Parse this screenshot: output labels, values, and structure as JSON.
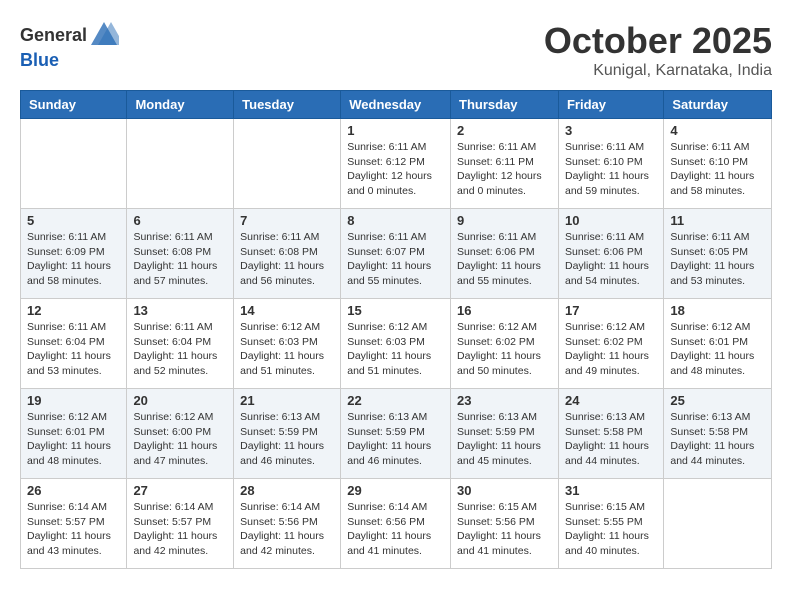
{
  "header": {
    "logo_general": "General",
    "logo_blue": "Blue",
    "month_title": "October 2025",
    "location": "Kunigal, Karnataka, India"
  },
  "weekdays": [
    "Sunday",
    "Monday",
    "Tuesday",
    "Wednesday",
    "Thursday",
    "Friday",
    "Saturday"
  ],
  "weeks": [
    [
      {
        "day": "",
        "sunrise": "",
        "sunset": "",
        "daylight": ""
      },
      {
        "day": "",
        "sunrise": "",
        "sunset": "",
        "daylight": ""
      },
      {
        "day": "",
        "sunrise": "",
        "sunset": "",
        "daylight": ""
      },
      {
        "day": "1",
        "sunrise": "Sunrise: 6:11 AM",
        "sunset": "Sunset: 6:12 PM",
        "daylight": "Daylight: 12 hours and 0 minutes."
      },
      {
        "day": "2",
        "sunrise": "Sunrise: 6:11 AM",
        "sunset": "Sunset: 6:11 PM",
        "daylight": "Daylight: 12 hours and 0 minutes."
      },
      {
        "day": "3",
        "sunrise": "Sunrise: 6:11 AM",
        "sunset": "Sunset: 6:10 PM",
        "daylight": "Daylight: 11 hours and 59 minutes."
      },
      {
        "day": "4",
        "sunrise": "Sunrise: 6:11 AM",
        "sunset": "Sunset: 6:10 PM",
        "daylight": "Daylight: 11 hours and 58 minutes."
      }
    ],
    [
      {
        "day": "5",
        "sunrise": "Sunrise: 6:11 AM",
        "sunset": "Sunset: 6:09 PM",
        "daylight": "Daylight: 11 hours and 58 minutes."
      },
      {
        "day": "6",
        "sunrise": "Sunrise: 6:11 AM",
        "sunset": "Sunset: 6:08 PM",
        "daylight": "Daylight: 11 hours and 57 minutes."
      },
      {
        "day": "7",
        "sunrise": "Sunrise: 6:11 AM",
        "sunset": "Sunset: 6:08 PM",
        "daylight": "Daylight: 11 hours and 56 minutes."
      },
      {
        "day": "8",
        "sunrise": "Sunrise: 6:11 AM",
        "sunset": "Sunset: 6:07 PM",
        "daylight": "Daylight: 11 hours and 55 minutes."
      },
      {
        "day": "9",
        "sunrise": "Sunrise: 6:11 AM",
        "sunset": "Sunset: 6:06 PM",
        "daylight": "Daylight: 11 hours and 55 minutes."
      },
      {
        "day": "10",
        "sunrise": "Sunrise: 6:11 AM",
        "sunset": "Sunset: 6:06 PM",
        "daylight": "Daylight: 11 hours and 54 minutes."
      },
      {
        "day": "11",
        "sunrise": "Sunrise: 6:11 AM",
        "sunset": "Sunset: 6:05 PM",
        "daylight": "Daylight: 11 hours and 53 minutes."
      }
    ],
    [
      {
        "day": "12",
        "sunrise": "Sunrise: 6:11 AM",
        "sunset": "Sunset: 6:04 PM",
        "daylight": "Daylight: 11 hours and 53 minutes."
      },
      {
        "day": "13",
        "sunrise": "Sunrise: 6:11 AM",
        "sunset": "Sunset: 6:04 PM",
        "daylight": "Daylight: 11 hours and 52 minutes."
      },
      {
        "day": "14",
        "sunrise": "Sunrise: 6:12 AM",
        "sunset": "Sunset: 6:03 PM",
        "daylight": "Daylight: 11 hours and 51 minutes."
      },
      {
        "day": "15",
        "sunrise": "Sunrise: 6:12 AM",
        "sunset": "Sunset: 6:03 PM",
        "daylight": "Daylight: 11 hours and 51 minutes."
      },
      {
        "day": "16",
        "sunrise": "Sunrise: 6:12 AM",
        "sunset": "Sunset: 6:02 PM",
        "daylight": "Daylight: 11 hours and 50 minutes."
      },
      {
        "day": "17",
        "sunrise": "Sunrise: 6:12 AM",
        "sunset": "Sunset: 6:02 PM",
        "daylight": "Daylight: 11 hours and 49 minutes."
      },
      {
        "day": "18",
        "sunrise": "Sunrise: 6:12 AM",
        "sunset": "Sunset: 6:01 PM",
        "daylight": "Daylight: 11 hours and 48 minutes."
      }
    ],
    [
      {
        "day": "19",
        "sunrise": "Sunrise: 6:12 AM",
        "sunset": "Sunset: 6:01 PM",
        "daylight": "Daylight: 11 hours and 48 minutes."
      },
      {
        "day": "20",
        "sunrise": "Sunrise: 6:12 AM",
        "sunset": "Sunset: 6:00 PM",
        "daylight": "Daylight: 11 hours and 47 minutes."
      },
      {
        "day": "21",
        "sunrise": "Sunrise: 6:13 AM",
        "sunset": "Sunset: 5:59 PM",
        "daylight": "Daylight: 11 hours and 46 minutes."
      },
      {
        "day": "22",
        "sunrise": "Sunrise: 6:13 AM",
        "sunset": "Sunset: 5:59 PM",
        "daylight": "Daylight: 11 hours and 46 minutes."
      },
      {
        "day": "23",
        "sunrise": "Sunrise: 6:13 AM",
        "sunset": "Sunset: 5:59 PM",
        "daylight": "Daylight: 11 hours and 45 minutes."
      },
      {
        "day": "24",
        "sunrise": "Sunrise: 6:13 AM",
        "sunset": "Sunset: 5:58 PM",
        "daylight": "Daylight: 11 hours and 44 minutes."
      },
      {
        "day": "25",
        "sunrise": "Sunrise: 6:13 AM",
        "sunset": "Sunset: 5:58 PM",
        "daylight": "Daylight: 11 hours and 44 minutes."
      }
    ],
    [
      {
        "day": "26",
        "sunrise": "Sunrise: 6:14 AM",
        "sunset": "Sunset: 5:57 PM",
        "daylight": "Daylight: 11 hours and 43 minutes."
      },
      {
        "day": "27",
        "sunrise": "Sunrise: 6:14 AM",
        "sunset": "Sunset: 5:57 PM",
        "daylight": "Daylight: 11 hours and 42 minutes."
      },
      {
        "day": "28",
        "sunrise": "Sunrise: 6:14 AM",
        "sunset": "Sunset: 5:56 PM",
        "daylight": "Daylight: 11 hours and 42 minutes."
      },
      {
        "day": "29",
        "sunrise": "Sunrise: 6:14 AM",
        "sunset": "Sunset: 6:56 PM",
        "daylight": "Daylight: 11 hours and 41 minutes."
      },
      {
        "day": "30",
        "sunrise": "Sunrise: 6:15 AM",
        "sunset": "Sunset: 5:56 PM",
        "daylight": "Daylight: 11 hours and 41 minutes."
      },
      {
        "day": "31",
        "sunrise": "Sunrise: 6:15 AM",
        "sunset": "Sunset: 5:55 PM",
        "daylight": "Daylight: 11 hours and 40 minutes."
      },
      {
        "day": "",
        "sunrise": "",
        "sunset": "",
        "daylight": ""
      }
    ]
  ]
}
